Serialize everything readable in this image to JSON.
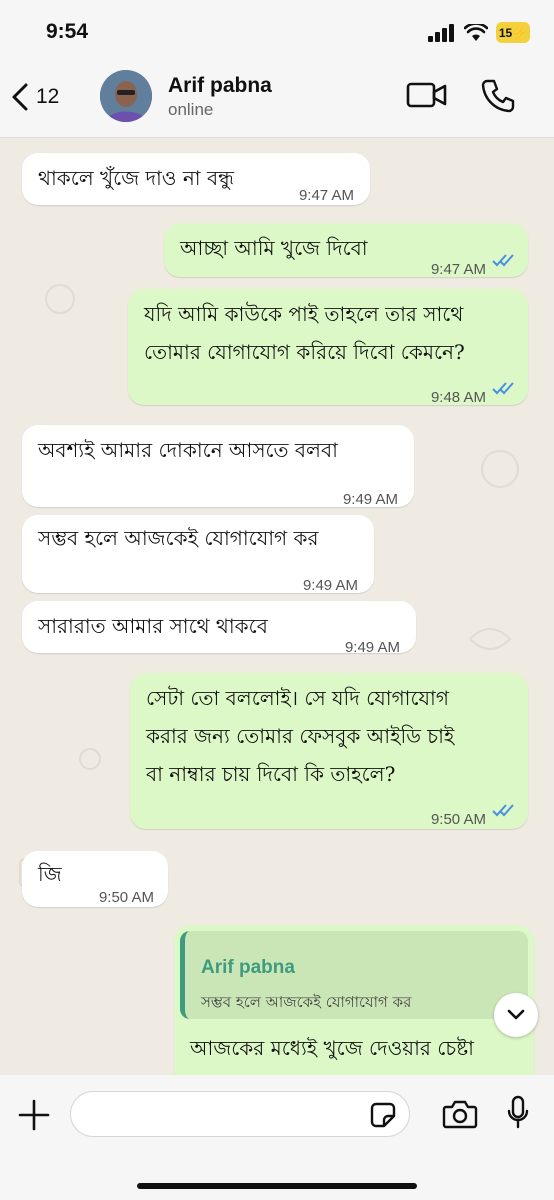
{
  "status_bar": {
    "time": "9:54",
    "battery": "15"
  },
  "header": {
    "back_count": "12",
    "name": "Arif pabna",
    "status": "online"
  },
  "messages": [
    {
      "dir": "in",
      "text": "থাকলে খুঁজে দাও না বন্ধু",
      "time": "9:47 AM"
    },
    {
      "dir": "out",
      "text": "আচ্ছা আমি খুজে দিবো",
      "time": "9:47 AM",
      "read": true
    },
    {
      "dir": "out",
      "text_lines": [
        "যদি আমি কাউকে পাই তাহলে তার সাথে",
        "তোমার যোগাযোগ করিয়ে দিবো কেমনে?"
      ],
      "time": "9:48 AM",
      "read": true
    },
    {
      "dir": "in",
      "text": "অবশ্যই আমার দোকানে আসতে বলবা",
      "time": "9:49 AM"
    },
    {
      "dir": "in",
      "text": "সম্ভব হলে আজকেই যোগাযোগ কর",
      "time": "9:49 AM"
    },
    {
      "dir": "in",
      "text": "সারারাত আমার সাথে থাকবে",
      "time": "9:49 AM"
    },
    {
      "dir": "out",
      "text_lines": [
        "সেটা তো বললোই। সে যদি যোগাযোগ",
        "করার জন্য তোমার ফেসবুক আইডি চাই",
        "বা নাম্বার চায় দিবো কি তাহলে?"
      ],
      "time": "9:50 AM",
      "read": true
    },
    {
      "dir": "in",
      "text": "জি",
      "time": "9:50 AM"
    },
    {
      "dir": "out",
      "reply_to": {
        "name": "Arif pabna",
        "text": "সম্ভব হলে আজকেই যোগাযোগ কর"
      },
      "text": "আজকের মধ্যেই খুজে দেওয়ার চেষ্টা"
    }
  ],
  "composer": {
    "placeholder": ""
  },
  "colors": {
    "chat_bg": "#efeae2",
    "incoming": "#ffffff",
    "outgoing": "#dbf8c6",
    "read_ticks": "#4a90e2",
    "reply_accent": "#3f9b7f"
  }
}
